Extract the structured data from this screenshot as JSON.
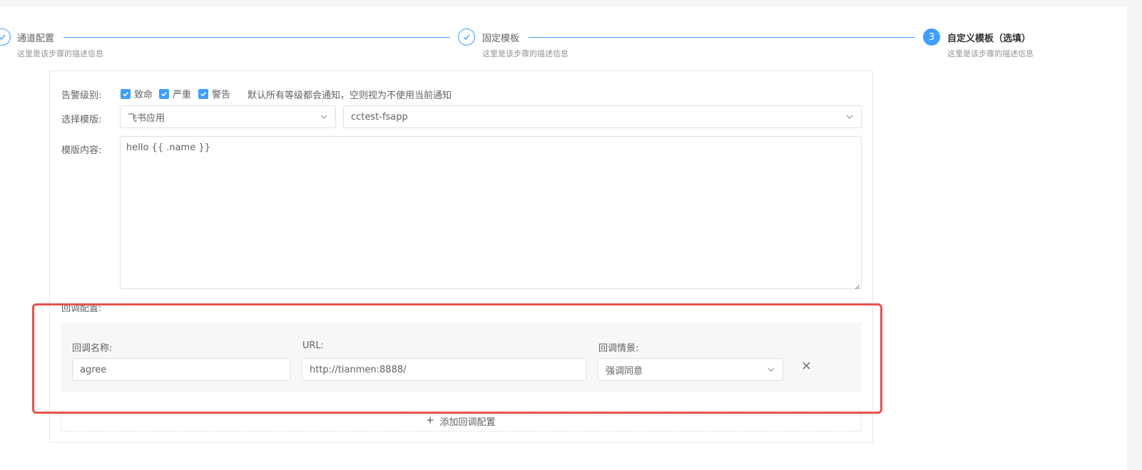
{
  "steps": [
    {
      "title": "通道配置",
      "desc": "这里是该步骤的描述信息",
      "status": "done"
    },
    {
      "title": "固定模板",
      "desc": "这里是该步骤的描述信息",
      "status": "done"
    },
    {
      "number": "3",
      "title": "自定义模板（选填）",
      "desc": "这里是该步骤的描述信息",
      "status": "active"
    }
  ],
  "form": {
    "alert_level": {
      "label": "告警级别:",
      "options": [
        {
          "label": "致命",
          "checked": true
        },
        {
          "label": "严重",
          "checked": true
        },
        {
          "label": "警告",
          "checked": true
        }
      ],
      "hint": "默认所有等级都会通知，空则视为不使用当前通知"
    },
    "template_select": {
      "label": "选择模版:",
      "type_value": "飞书应用",
      "app_value": "cctest-fsapp"
    },
    "template_content": {
      "label": "模版内容:",
      "value": "hello {{ .name }}"
    },
    "callback": {
      "label": "回调配置:",
      "name_label": "回调名称:",
      "url_label": "URL:",
      "scenario_label": "回调情景:",
      "item": {
        "name": "agree",
        "url": "http://tianmen:8888/",
        "scenario": "强调同意"
      },
      "add_label": "添加回调配置"
    }
  },
  "colors": {
    "primary": "#409eff",
    "highlight": "#e5534b"
  },
  "icons": {
    "check": "check-icon",
    "chevron": "chevron-down-icon",
    "close": "close-icon",
    "plus": "plus-icon"
  }
}
